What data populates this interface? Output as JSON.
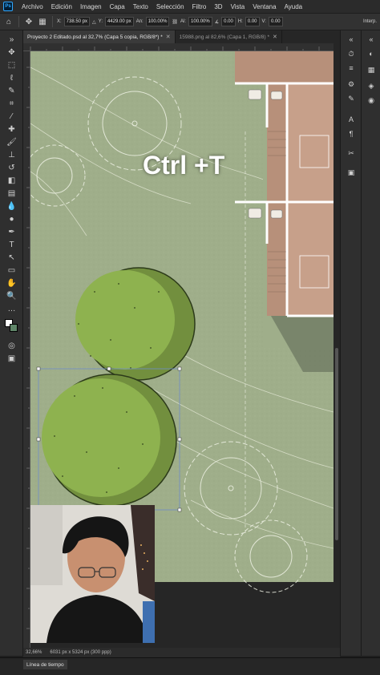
{
  "menubar": {
    "items": [
      "Archivo",
      "Edición",
      "Imagen",
      "Capa",
      "Texto",
      "Selección",
      "Filtro",
      "3D",
      "Vista",
      "Ventana",
      "Ayuda"
    ]
  },
  "optionsbar": {
    "x_label": "X:",
    "x_value": "738.50 px",
    "y_label": "Y:",
    "y_value": "4429.00 px",
    "w_label": "An:",
    "w_value": "100.00%",
    "h_label": "Al:",
    "h_value": "100.00%",
    "angle_label": "∡",
    "angle_value": "0.00",
    "h_skew_label": "H:",
    "h_skew_value": "0.00",
    "v_skew_label": "V:",
    "v_skew_value": "0.00",
    "interp_label": "Interp."
  },
  "tabs": [
    {
      "label": "Proyecto 2 Editado.psd al 32,7% (Capa 5 copia, RGB/8*) *",
      "active": true
    },
    {
      "label": "15988.png al 82,6% (Capa 1, RGB/8) *",
      "active": false
    }
  ],
  "canvas": {
    "overlay_text": "Ctrl +T"
  },
  "statusbar": {
    "zoom": "32,66%",
    "doc_info": "6031 px x 5324 px (300 ppp)"
  },
  "timeline": {
    "label": "Línea de tiempo"
  },
  "colors": {
    "grass": "#9fae8a",
    "tree_green": "#8eb24f",
    "tree_outline": "#2c3a1a",
    "deck": "#b7907a",
    "selection": "#6f8cc8"
  }
}
